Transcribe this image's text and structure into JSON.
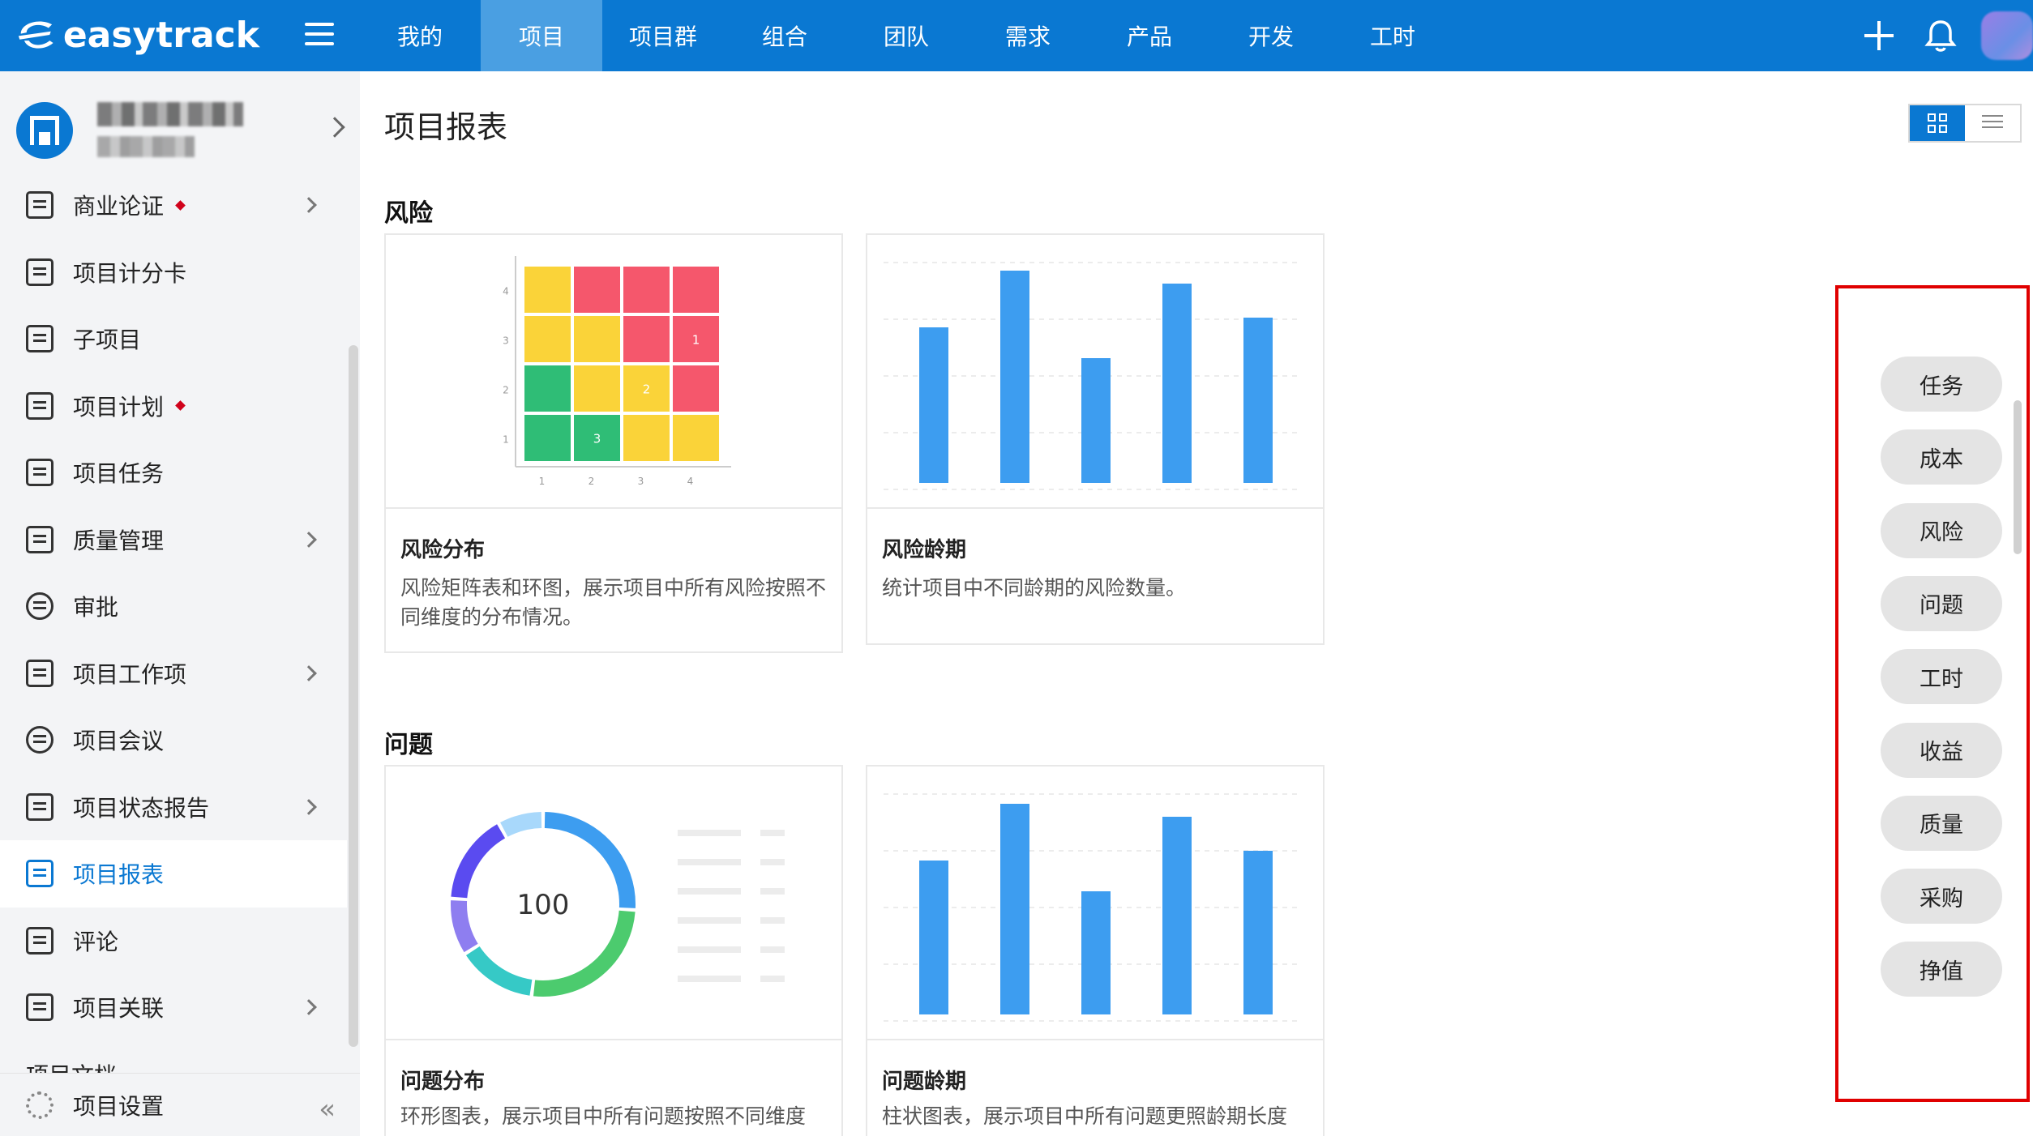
{
  "app": {
    "brand": "easytrack",
    "nav": [
      "我的",
      "项目",
      "项目群",
      "组合",
      "团队",
      "需求",
      "产品",
      "开发",
      "工时"
    ],
    "active_nav": "项目"
  },
  "sidebar": {
    "items": [
      {
        "label": "商业论证",
        "dot": true,
        "chevron": true,
        "icon": "business-case-icon"
      },
      {
        "label": "项目计分卡",
        "dot": false,
        "chevron": false,
        "icon": "scorecard-icon"
      },
      {
        "label": "子项目",
        "dot": false,
        "chevron": false,
        "icon": "subproject-icon"
      },
      {
        "label": "项目计划",
        "dot": true,
        "chevron": false,
        "icon": "plan-icon"
      },
      {
        "label": "项目任务",
        "dot": false,
        "chevron": false,
        "icon": "task-icon"
      },
      {
        "label": "质量管理",
        "dot": false,
        "chevron": true,
        "icon": "quality-icon"
      },
      {
        "label": "审批",
        "dot": false,
        "chevron": false,
        "icon": "approval-icon"
      },
      {
        "label": "项目工作项",
        "dot": false,
        "chevron": true,
        "icon": "work-item-icon"
      },
      {
        "label": "项目会议",
        "dot": false,
        "chevron": false,
        "icon": "meeting-icon"
      },
      {
        "label": "项目状态报告",
        "dot": false,
        "chevron": true,
        "icon": "status-report-icon"
      },
      {
        "label": "项目报表",
        "dot": false,
        "chevron": false,
        "icon": "report-icon",
        "active": true
      },
      {
        "label": "评论",
        "dot": false,
        "chevron": false,
        "icon": "comment-icon"
      },
      {
        "label": "项目关联",
        "dot": false,
        "chevron": true,
        "icon": "link-icon"
      }
    ],
    "partial_item": "项目文档",
    "footer_label": "项目设置",
    "collapse_glyph": "«"
  },
  "main": {
    "title": "项目报表",
    "sections": [
      {
        "title": "风险",
        "cards": [
          {
            "title": "风险分布",
            "desc": "风险矩阵表和环图，展示项目中所有风险按照不同维度的分布情况。"
          },
          {
            "title": "风险龄期",
            "desc": "统计项目中不同龄期的风险数量。"
          }
        ]
      },
      {
        "title": "问题",
        "cards": [
          {
            "title": "问题分布",
            "desc": "环形图表，展示项目中所有问题按照不同维度"
          },
          {
            "title": "问题龄期",
            "desc": "柱状图表，展示项目中所有问题更照龄期长度"
          }
        ]
      }
    ],
    "donut_center": "100",
    "matrix_labels": [
      "1",
      "2",
      "3"
    ],
    "matrix_axis_y": [
      "4",
      "3",
      "2",
      "1"
    ],
    "matrix_axis_x": [
      "1",
      "2",
      "3",
      "4"
    ]
  },
  "right_panel": {
    "buttons": [
      "任务",
      "成本",
      "风险",
      "问题",
      "工时",
      "收益",
      "质量",
      "采购",
      "挣值"
    ]
  },
  "colors": {
    "brand": "#0a78d2",
    "bar": "#3d9df0",
    "matrix_red": "#f5576c",
    "matrix_yellow": "#fad339",
    "matrix_green": "#2fbd76"
  }
}
